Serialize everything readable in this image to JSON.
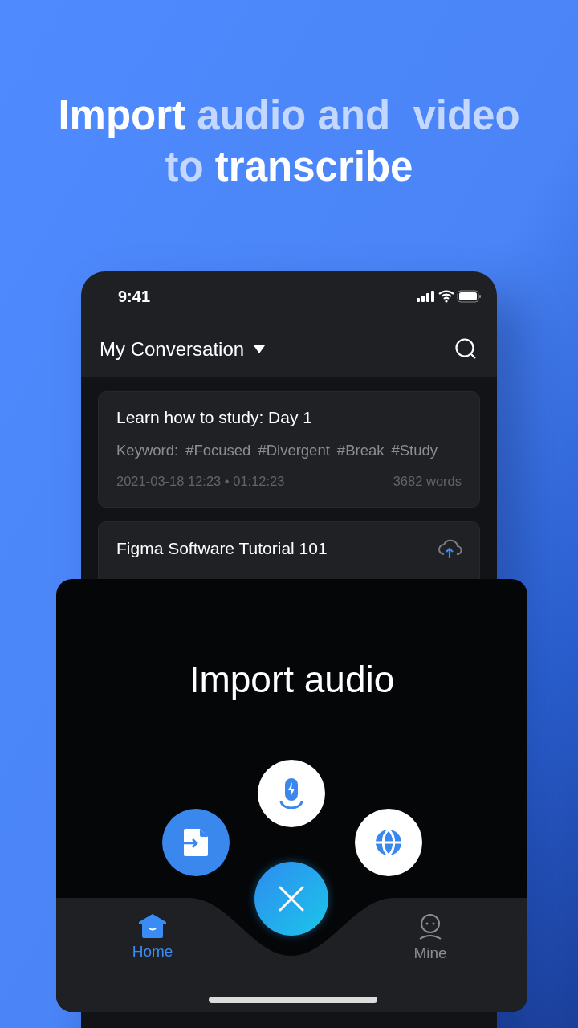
{
  "headline": [
    [
      {
        "text": "Import",
        "highlight": false
      },
      {
        "text": "audio and  video",
        "highlight": true
      }
    ],
    [
      {
        "text": "to",
        "highlight": true
      },
      {
        "text": "transcribe",
        "highlight": false
      }
    ]
  ],
  "status_bar": {
    "time": "9:41"
  },
  "header": {
    "title": "My Conversation"
  },
  "conversations": [
    {
      "title": "Learn how to study: Day 1",
      "keyword_label": "Keyword:",
      "tags": [
        "#Focused",
        "#Divergent",
        "#Break",
        "#Study"
      ],
      "meta": "2021-03-18 12:23 • 01:12:23",
      "words": "3682 words",
      "uploading": false
    },
    {
      "title": "Figma Software Tutorial 101",
      "uploading": true
    }
  ],
  "import_sheet": {
    "title": "Import audio",
    "actions": [
      {
        "kind": "file",
        "selected": true
      },
      {
        "kind": "record",
        "selected": false
      },
      {
        "kind": "link",
        "selected": false
      }
    ]
  },
  "tabs": [
    {
      "kind": "home",
      "label": "Home",
      "selected": true
    },
    {
      "kind": "profile",
      "label": "Mine",
      "selected": false
    }
  ]
}
